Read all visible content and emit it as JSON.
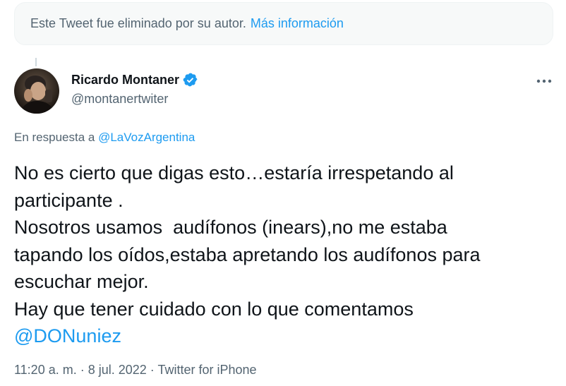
{
  "deleted_notice": {
    "text": "Este Tweet fue eliminado por su autor.",
    "link": "Más información"
  },
  "author": {
    "name": "Ricardo Montaner",
    "handle": "@montanertwiter",
    "verified": true
  },
  "reply": {
    "prefix": "En respuesta a ",
    "mention": "@LaVozArgentina"
  },
  "tweet": {
    "lines": [
      "No es cierto que digas esto…estaría irrespetando al",
      "participante .",
      "Nosotros usamos  audífonos (inears),no me estaba",
      "tapando los oídos,estaba apretando los audífonos para",
      "escuchar mejor.",
      "Hay que tener cuidado con lo que comentamos"
    ],
    "mention": "@DONuniez"
  },
  "meta": {
    "time": "11:20 a. m.",
    "separator": " · ",
    "date": "8 jul. 2022",
    "source": "Twitter for iPhone"
  },
  "colors": {
    "accent": "#1d9bf0",
    "secondary_text": "#536471",
    "primary_text": "#0f1419"
  },
  "icons": {
    "verified": "verified-badge-icon",
    "more": "more-options-icon"
  }
}
